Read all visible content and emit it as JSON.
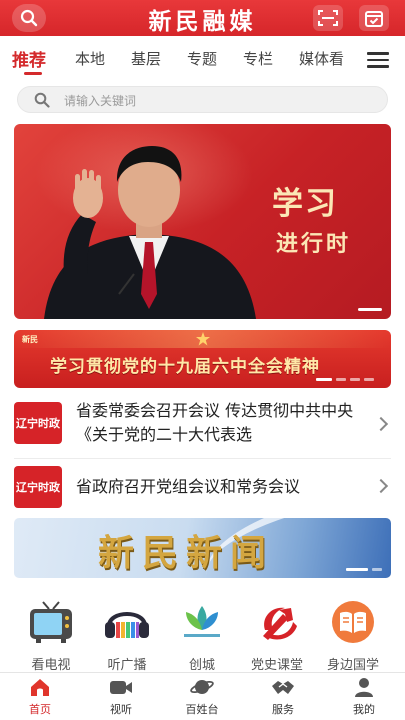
{
  "header": {
    "brand": "新民融媒",
    "search_icon": "search-icon",
    "scan_icon": "scan-icon",
    "calendar_icon": "calendar-check-icon",
    "color": "#d6262a"
  },
  "tabs": {
    "items": [
      "推荐",
      "本地",
      "基层",
      "专题",
      "专栏",
      "媒体看"
    ],
    "active": "推荐",
    "menu_icon": "menu-icon"
  },
  "search": {
    "placeholder": "请输入关键词"
  },
  "hero": {
    "title_line1": "学习",
    "title_line2": "进行时"
  },
  "banner": {
    "logo": "新民",
    "text": "学习贯彻党的十九届六中全会精神"
  },
  "news": [
    {
      "badge": "辽宁时政",
      "title": "省委常委会召开会议 传达贯彻中共中央《关于党的二十大代表选"
    },
    {
      "badge": "辽宁时政",
      "title": "省政府召开党组会议和常务会议"
    }
  ],
  "xinmin_banner": {
    "text": "新民新闻"
  },
  "services": [
    {
      "label": "看电视",
      "icon": "tv-icon"
    },
    {
      "label": "听广播",
      "icon": "radio-icon"
    },
    {
      "label": "创城",
      "icon": "lotus-logo-icon"
    },
    {
      "label": "党史课堂",
      "icon": "party-emblem-icon"
    },
    {
      "label": "身边国学",
      "icon": "book-icon"
    }
  ],
  "bottom_nav": {
    "items": [
      {
        "label": "首页",
        "icon": "home-icon"
      },
      {
        "label": "视听",
        "icon": "video-icon"
      },
      {
        "label": "百姓台",
        "icon": "planet-icon"
      },
      {
        "label": "服务",
        "icon": "handshake-icon"
      },
      {
        "label": "我的",
        "icon": "user-icon"
      }
    ],
    "active": "首页",
    "active_color": "#d42a2c"
  }
}
